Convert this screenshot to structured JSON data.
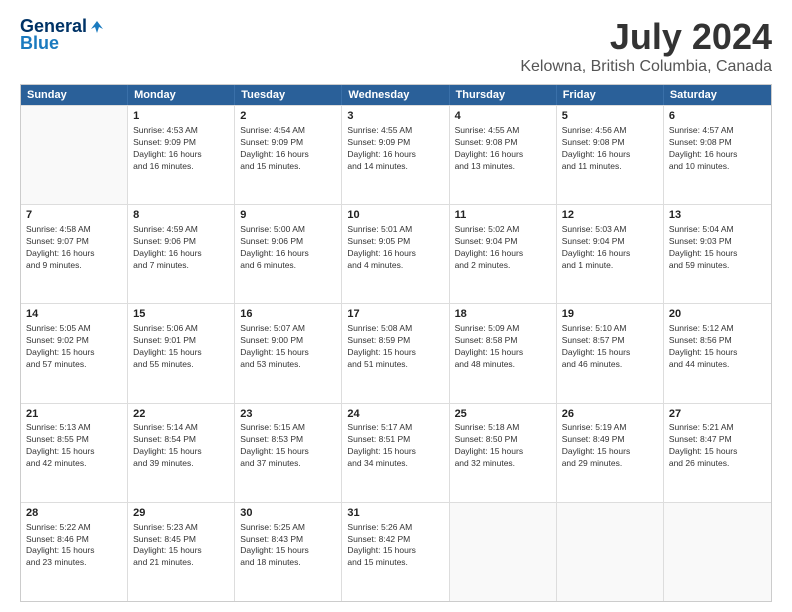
{
  "logo": {
    "line1": "General",
    "line2": "Blue"
  },
  "title": "July 2024",
  "subtitle": "Kelowna, British Columbia, Canada",
  "header_days": [
    "Sunday",
    "Monday",
    "Tuesday",
    "Wednesday",
    "Thursday",
    "Friday",
    "Saturday"
  ],
  "weeks": [
    [
      {
        "day": "",
        "info": ""
      },
      {
        "day": "1",
        "info": "Sunrise: 4:53 AM\nSunset: 9:09 PM\nDaylight: 16 hours\nand 16 minutes."
      },
      {
        "day": "2",
        "info": "Sunrise: 4:54 AM\nSunset: 9:09 PM\nDaylight: 16 hours\nand 15 minutes."
      },
      {
        "day": "3",
        "info": "Sunrise: 4:55 AM\nSunset: 9:09 PM\nDaylight: 16 hours\nand 14 minutes."
      },
      {
        "day": "4",
        "info": "Sunrise: 4:55 AM\nSunset: 9:08 PM\nDaylight: 16 hours\nand 13 minutes."
      },
      {
        "day": "5",
        "info": "Sunrise: 4:56 AM\nSunset: 9:08 PM\nDaylight: 16 hours\nand 11 minutes."
      },
      {
        "day": "6",
        "info": "Sunrise: 4:57 AM\nSunset: 9:08 PM\nDaylight: 16 hours\nand 10 minutes."
      }
    ],
    [
      {
        "day": "7",
        "info": "Sunrise: 4:58 AM\nSunset: 9:07 PM\nDaylight: 16 hours\nand 9 minutes."
      },
      {
        "day": "8",
        "info": "Sunrise: 4:59 AM\nSunset: 9:06 PM\nDaylight: 16 hours\nand 7 minutes."
      },
      {
        "day": "9",
        "info": "Sunrise: 5:00 AM\nSunset: 9:06 PM\nDaylight: 16 hours\nand 6 minutes."
      },
      {
        "day": "10",
        "info": "Sunrise: 5:01 AM\nSunset: 9:05 PM\nDaylight: 16 hours\nand 4 minutes."
      },
      {
        "day": "11",
        "info": "Sunrise: 5:02 AM\nSunset: 9:04 PM\nDaylight: 16 hours\nand 2 minutes."
      },
      {
        "day": "12",
        "info": "Sunrise: 5:03 AM\nSunset: 9:04 PM\nDaylight: 16 hours\nand 1 minute."
      },
      {
        "day": "13",
        "info": "Sunrise: 5:04 AM\nSunset: 9:03 PM\nDaylight: 15 hours\nand 59 minutes."
      }
    ],
    [
      {
        "day": "14",
        "info": "Sunrise: 5:05 AM\nSunset: 9:02 PM\nDaylight: 15 hours\nand 57 minutes."
      },
      {
        "day": "15",
        "info": "Sunrise: 5:06 AM\nSunset: 9:01 PM\nDaylight: 15 hours\nand 55 minutes."
      },
      {
        "day": "16",
        "info": "Sunrise: 5:07 AM\nSunset: 9:00 PM\nDaylight: 15 hours\nand 53 minutes."
      },
      {
        "day": "17",
        "info": "Sunrise: 5:08 AM\nSunset: 8:59 PM\nDaylight: 15 hours\nand 51 minutes."
      },
      {
        "day": "18",
        "info": "Sunrise: 5:09 AM\nSunset: 8:58 PM\nDaylight: 15 hours\nand 48 minutes."
      },
      {
        "day": "19",
        "info": "Sunrise: 5:10 AM\nSunset: 8:57 PM\nDaylight: 15 hours\nand 46 minutes."
      },
      {
        "day": "20",
        "info": "Sunrise: 5:12 AM\nSunset: 8:56 PM\nDaylight: 15 hours\nand 44 minutes."
      }
    ],
    [
      {
        "day": "21",
        "info": "Sunrise: 5:13 AM\nSunset: 8:55 PM\nDaylight: 15 hours\nand 42 minutes."
      },
      {
        "day": "22",
        "info": "Sunrise: 5:14 AM\nSunset: 8:54 PM\nDaylight: 15 hours\nand 39 minutes."
      },
      {
        "day": "23",
        "info": "Sunrise: 5:15 AM\nSunset: 8:53 PM\nDaylight: 15 hours\nand 37 minutes."
      },
      {
        "day": "24",
        "info": "Sunrise: 5:17 AM\nSunset: 8:51 PM\nDaylight: 15 hours\nand 34 minutes."
      },
      {
        "day": "25",
        "info": "Sunrise: 5:18 AM\nSunset: 8:50 PM\nDaylight: 15 hours\nand 32 minutes."
      },
      {
        "day": "26",
        "info": "Sunrise: 5:19 AM\nSunset: 8:49 PM\nDaylight: 15 hours\nand 29 minutes."
      },
      {
        "day": "27",
        "info": "Sunrise: 5:21 AM\nSunset: 8:47 PM\nDaylight: 15 hours\nand 26 minutes."
      }
    ],
    [
      {
        "day": "28",
        "info": "Sunrise: 5:22 AM\nSunset: 8:46 PM\nDaylight: 15 hours\nand 23 minutes."
      },
      {
        "day": "29",
        "info": "Sunrise: 5:23 AM\nSunset: 8:45 PM\nDaylight: 15 hours\nand 21 minutes."
      },
      {
        "day": "30",
        "info": "Sunrise: 5:25 AM\nSunset: 8:43 PM\nDaylight: 15 hours\nand 18 minutes."
      },
      {
        "day": "31",
        "info": "Sunrise: 5:26 AM\nSunset: 8:42 PM\nDaylight: 15 hours\nand 15 minutes."
      },
      {
        "day": "",
        "info": ""
      },
      {
        "day": "",
        "info": ""
      },
      {
        "day": "",
        "info": ""
      }
    ]
  ]
}
